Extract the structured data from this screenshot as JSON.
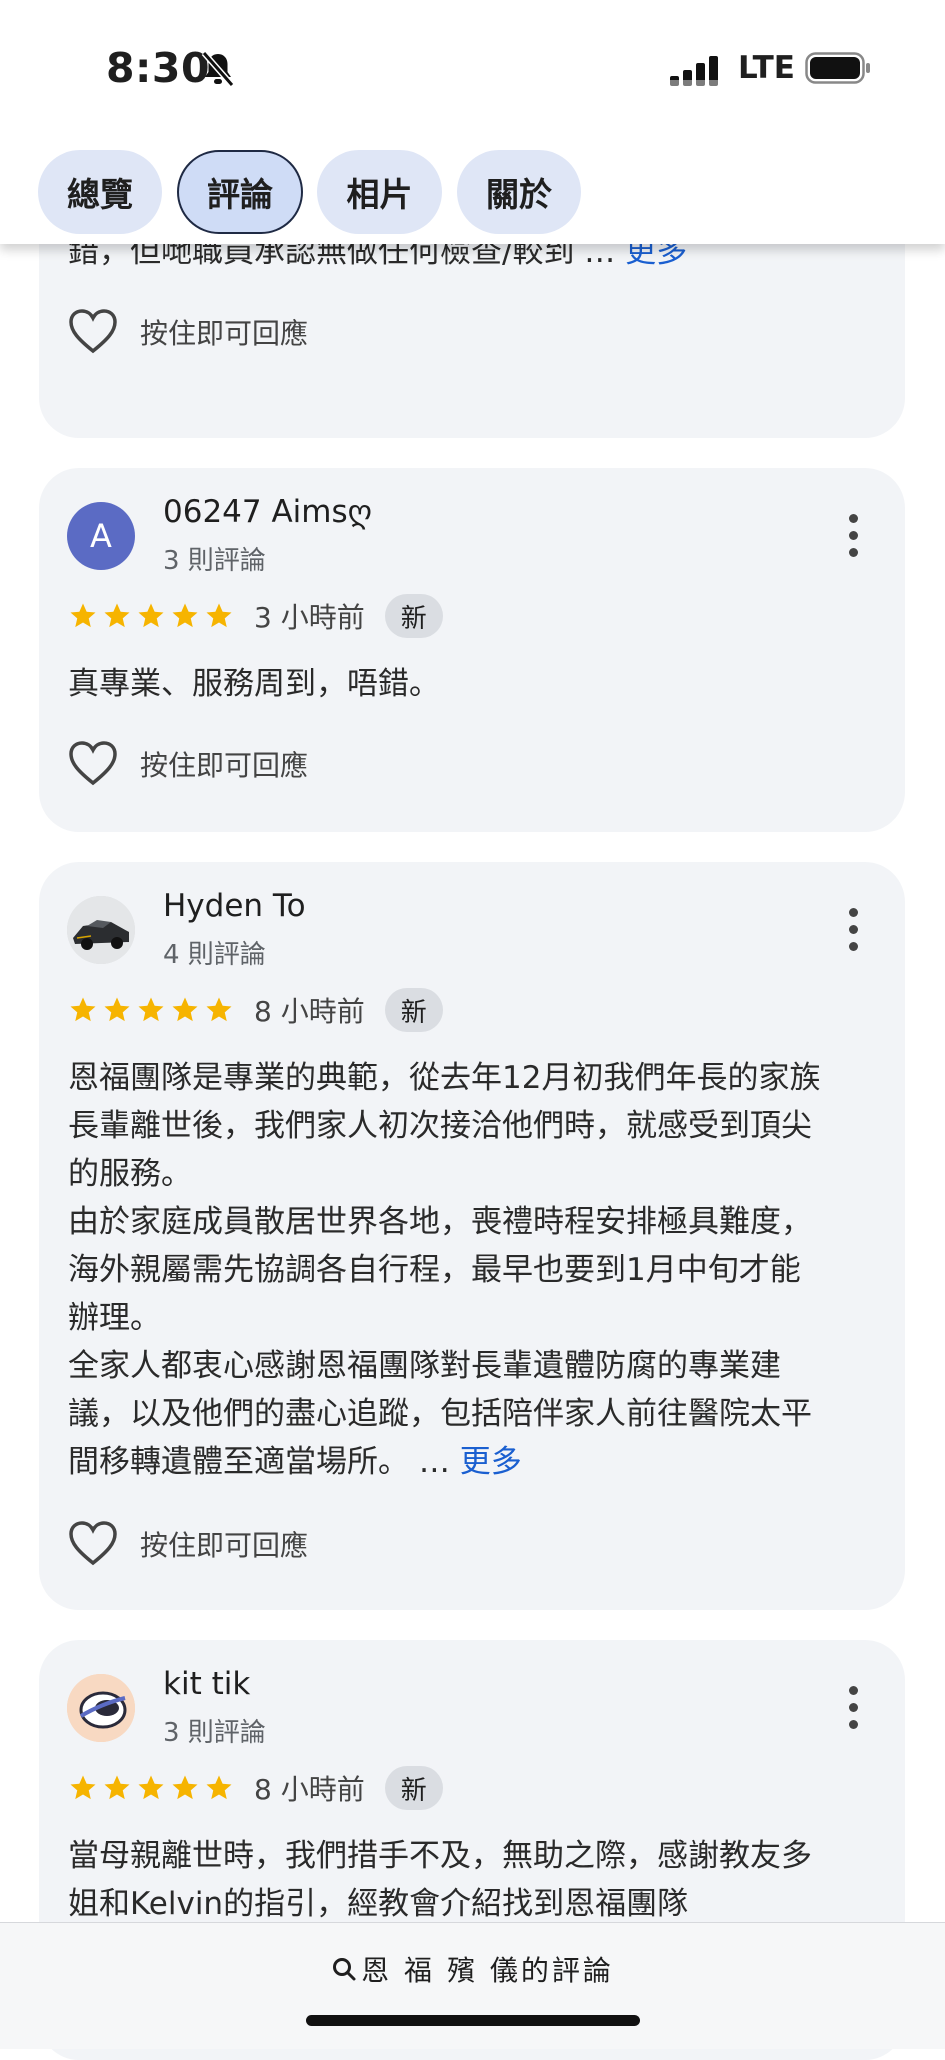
{
  "status_bar": {
    "time": "8:30",
    "network": "LTE"
  },
  "tabs": [
    {
      "label": "總覽"
    },
    {
      "label": "評論"
    },
    {
      "label": "相片"
    },
    {
      "label": "關於"
    }
  ],
  "react_label": "按住即可回應",
  "more_label": "更多",
  "new_badge": "新",
  "partial_review": {
    "text_tail": "錯，但哋職員承認無做任何檢查/較到 …"
  },
  "reviews": [
    {
      "name": "06247 Aimsღ",
      "avatar_letter": "A",
      "review_count": "3 則評論",
      "rating": 5,
      "time_ago": "3 小時前",
      "text": "真專業、服務周到，唔錯。"
    },
    {
      "name": "Hyden To",
      "review_count": "4 則評論",
      "rating": 5,
      "time_ago": "8 小時前",
      "text_lines": [
        "恩福團隊是專業的典範，從去年12月初我們年長的家族",
        "長輩離世後，我們家人初次接洽他們時，就感受到頂尖",
        "的服務。",
        "由於家庭成員散居世界各地，喪禮時程安排極具難度，",
        "海外親屬需先協調各自行程，最早也要到1月中旬才能",
        "辦理。",
        "全家人都衷心感謝恩福團隊對長輩遺體防腐的專業建",
        "議，以及他們的盡心追蹤，包括陪伴家人前往醫院太平",
        "間移轉遺體至適當場所。 …"
      ]
    },
    {
      "name": "kit tik",
      "review_count": "3 則評論",
      "rating": 5,
      "time_ago": "8 小時前",
      "text_lines": [
        "當母親離世時，我們措手不及，無助之際，感謝教友多",
        "姐和Kelvin的指引，經教會介紹找到恩福團隊"
      ]
    }
  ],
  "bottom_bar": {
    "label": "恩 福 殯 儀的評論"
  },
  "colors": {
    "star": "#f6b400",
    "link": "#1a5fd0",
    "card": "#f2f4f7",
    "tab": "#dfe6f6",
    "avatar_a": "#5b6bc4"
  }
}
